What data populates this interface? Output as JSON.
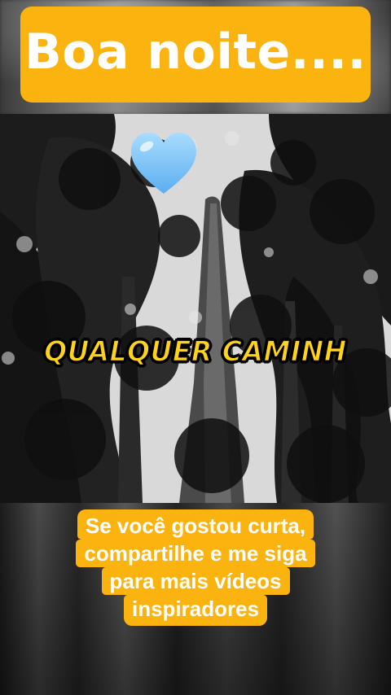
{
  "title": "Boa noite....",
  "caption": "QUALQUER CAMINH",
  "cta": {
    "lines": [
      "Se você gostou curta,",
      "compartilhe e me siga",
      "para mais vídeos",
      "inspiradores"
    ]
  },
  "colors": {
    "accent": "#fbb40f",
    "caption": "#ffd21e",
    "heart": "#7ec3f5"
  },
  "icons": {
    "heart": "blue-heart-icon"
  }
}
